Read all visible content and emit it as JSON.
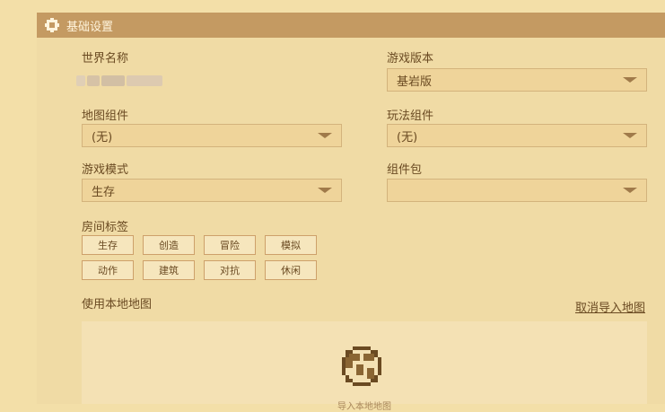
{
  "header": {
    "title": "基础设置",
    "icon": "gear-icon"
  },
  "fields": {
    "world_name_label": "世界名称",
    "game_version_label": "游戏版本",
    "game_version_value": "基岩版",
    "map_component_label": "地图组件",
    "map_component_value": "(无)",
    "gameplay_component_label": "玩法组件",
    "gameplay_component_value": "(无)",
    "game_mode_label": "游戏模式",
    "game_mode_value": "生存",
    "component_pack_label": "组件包",
    "component_pack_value": ""
  },
  "room_tags": {
    "label": "房间标签",
    "tags": [
      "生存",
      "创造",
      "冒险",
      "模拟",
      "动作",
      "建筑",
      "对抗",
      "休闲"
    ]
  },
  "local_map": {
    "label": "使用本地地图",
    "cancel_import": "取消导入地图",
    "import_text": "导入本地地图",
    "icon": "import-map-icon"
  },
  "colors": {
    "page_bg": "#f3dfa8",
    "header_bg": "#c49a62",
    "text": "#6a4a22"
  }
}
